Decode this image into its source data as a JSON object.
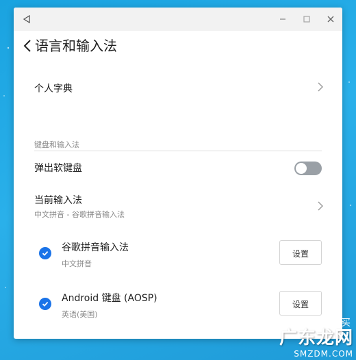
{
  "page": {
    "title": "语言和输入法"
  },
  "personal_dictionary": {
    "label": "个人字典"
  },
  "section": {
    "header": "键盘和输入法"
  },
  "soft_keyboard": {
    "label": "弹出软键盘",
    "enabled": false
  },
  "current_ime": {
    "label": "当前输入法",
    "value": "中文拼音 - 谷歌拼音输入法"
  },
  "ime_list": [
    {
      "name": "谷歌拼音输入法",
      "subtitle": "中文拼音",
      "checked": true,
      "button": "设置"
    },
    {
      "name": "Android 键盘 (AOSP)",
      "subtitle": "英语(美国)",
      "checked": true,
      "button": "设置"
    }
  ],
  "colors": {
    "accent": "#1a73e8",
    "toggle_off": "#9aa0a6",
    "desktop": "#1aa3e0"
  },
  "icons": {
    "titlebar_left": "back-triangle-icon",
    "minimize": "minimize-icon",
    "maximize": "maximize-icon",
    "close": "close-icon",
    "back": "chevron-left-icon",
    "row_arrow": "chevron-right-icon",
    "check": "check-circle-icon"
  },
  "watermark": {
    "main": "广东龙网",
    "side": "得买",
    "url": "SMZDM.COM"
  }
}
